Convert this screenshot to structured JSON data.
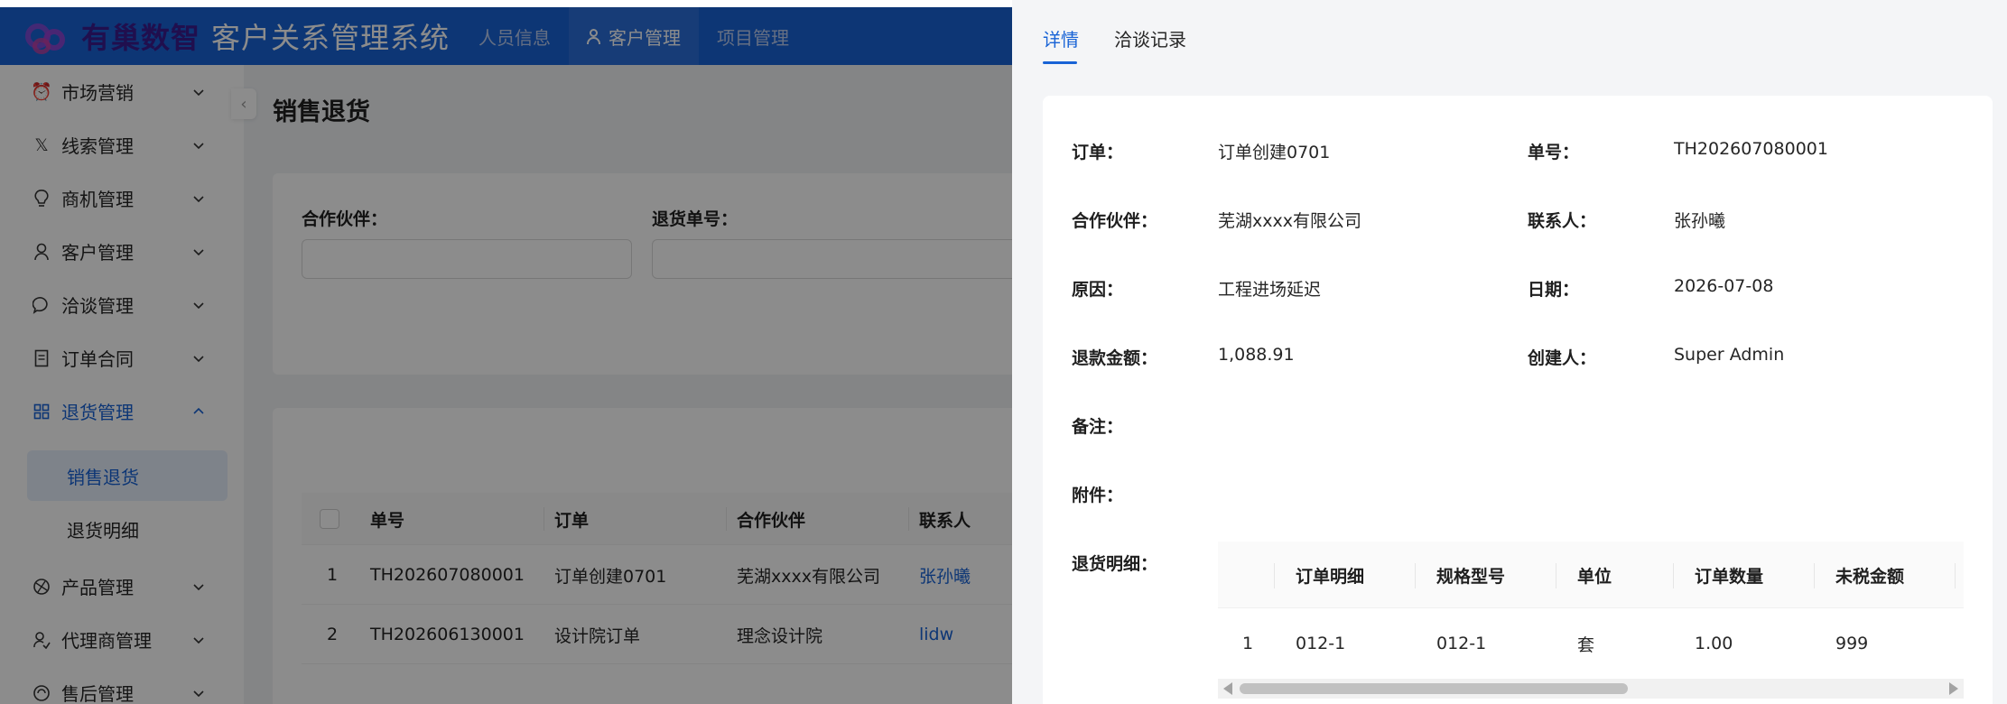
{
  "header": {
    "brand": "有巢数智",
    "system_title": "客户关系管理系统",
    "nav": [
      {
        "label": "人员信息"
      },
      {
        "label": "客户管理",
        "active": true
      },
      {
        "label": "项目管理"
      }
    ]
  },
  "sidebar": {
    "items": [
      {
        "label": "市场营销",
        "icon": "alarm-icon"
      },
      {
        "label": "线索管理",
        "icon": "x-icon"
      },
      {
        "label": "商机管理",
        "icon": "bulb-icon"
      },
      {
        "label": "客户管理",
        "icon": "user-icon"
      },
      {
        "label": "洽谈管理",
        "icon": "chat-icon"
      },
      {
        "label": "订单合同",
        "icon": "document-icon"
      },
      {
        "label": "退货管理",
        "icon": "grid-icon",
        "open": true
      },
      {
        "label": "产品管理",
        "icon": "box-icon"
      },
      {
        "label": "代理商管理",
        "icon": "agent-icon"
      },
      {
        "label": "售后管理",
        "icon": "service-icon"
      }
    ],
    "sub_items": [
      {
        "label": "销售退货",
        "active": true
      },
      {
        "label": "退货明细"
      }
    ]
  },
  "main": {
    "page_title": "销售退货",
    "filters": {
      "partner_label": "合作伙伴：",
      "return_no_label": "退货单号："
    },
    "table": {
      "columns": [
        "单号",
        "订单",
        "合作伙伴",
        "联系人"
      ],
      "rows": [
        {
          "index": "1",
          "no": "TH202607080001",
          "order": "订单创建0701",
          "partner": "芜湖xxxx有限公司",
          "contact": "张孙曦"
        },
        {
          "index": "2",
          "no": "TH202606130001",
          "order": "设计院订单",
          "partner": "理念设计院",
          "contact": "lidw"
        }
      ]
    }
  },
  "drawer": {
    "tabs": [
      {
        "label": "详情",
        "active": true
      },
      {
        "label": "洽谈记录"
      }
    ],
    "fields": {
      "order_label": "订单：",
      "order_value": "订单创建0701",
      "no_label": "单号：",
      "no_value": "TH202607080001",
      "partner_label": "合作伙伴：",
      "partner_value": "芜湖xxxx有限公司",
      "contact_label": "联系人：",
      "contact_value": "张孙曦",
      "reason_label": "原因：",
      "reason_value": "工程进场延迟",
      "date_label": "日期：",
      "date_value": "2026-07-08",
      "refund_label": "退款金额：",
      "refund_value": "1,088.91",
      "creator_label": "创建人：",
      "creator_value": "Super Admin",
      "remark_label": "备注：",
      "attachment_label": "附件：",
      "detail_label": "退货明细："
    },
    "detail_table": {
      "columns": [
        "订单明细",
        "规格型号",
        "单位",
        "订单数量",
        "未税金额"
      ],
      "rows": [
        {
          "index": "1",
          "item": "012-1",
          "spec": "012-1",
          "unit": "套",
          "qty": "1.00",
          "amount": "999"
        }
      ]
    }
  },
  "colors": {
    "primary": "#1863d6",
    "header_bg": "#1863d6",
    "overlay": "rgba(0,0,0,0.45)"
  }
}
